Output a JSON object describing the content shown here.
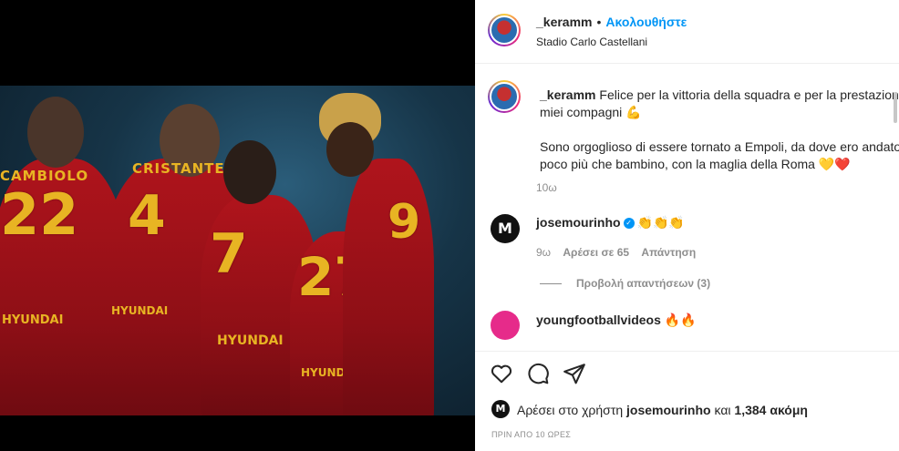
{
  "post": {
    "author": "_keramm",
    "follow_label": "Ακολουθήστε",
    "separator": "•",
    "location": "Stadio Carlo Castellani"
  },
  "photo": {
    "players": [
      {
        "number": "22",
        "name": "CAMBIOLO"
      },
      {
        "number": "4",
        "name": "CRISTANTE"
      },
      {
        "number": "7",
        "name": ""
      },
      {
        "number": "27",
        "name": ""
      },
      {
        "number": "9",
        "name": ""
      }
    ],
    "sponsor": "HYUNDAI"
  },
  "caption": {
    "username": "_keramm",
    "line1": "Felice per la vittoria della squadra e per la prestazione",
    "line2": "miei compagni 💪",
    "line3": "Sono orgoglioso di essere tornato a Empoli, da dove ero andato",
    "line4": "poco più che bambino, con la maglia della Roma 💛❤️",
    "age": "10ω"
  },
  "comments": [
    {
      "username": "josemourinho",
      "verified": true,
      "text": "👏👏👏",
      "age": "9ω",
      "likes_label": "Αρέσει σε 65",
      "reply_label": "Απάντηση",
      "view_replies": "Προβολή απαντήσεων (3)"
    },
    {
      "username": "youngfootballvideos",
      "text": "🔥🔥"
    }
  ],
  "actions": {
    "like_icon": "heart-outline",
    "comment_icon": "speech-bubble",
    "share_icon": "paper-plane"
  },
  "likes": {
    "prefix": "Αρέσει στο χρήστη",
    "user": "josemourinho",
    "middle": "και",
    "count": "1,384 ακόμη"
  },
  "timestamp": "ΠΡΙΝ ΑΠΟ 10 ΩΡΕΣ",
  "colors": {
    "accent": "#0095f6",
    "text": "#262626",
    "muted": "#8e8e8e",
    "jersey": "#b0141c",
    "jersey_print": "#e8b423"
  }
}
